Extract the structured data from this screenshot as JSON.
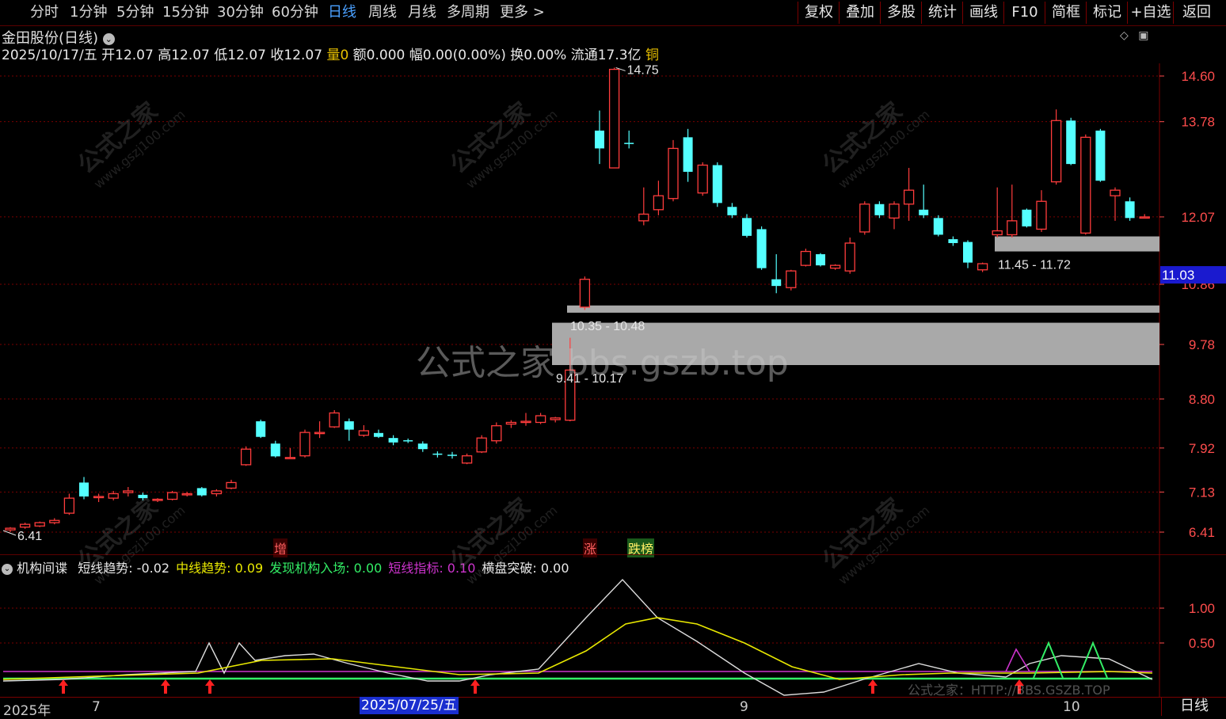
{
  "toolbar": {
    "periods": [
      "分时",
      "1分钟",
      "5分钟",
      "15分钟",
      "30分钟",
      "60分钟",
      "日线",
      "周线",
      "月线",
      "多周期",
      "更多 >"
    ],
    "active_period": "日线",
    "right_buttons": [
      "复权",
      "叠加",
      "多股",
      "统计",
      "画线",
      "F10",
      "简框",
      "标记",
      "+自选",
      "返回"
    ]
  },
  "stock": {
    "name": "金田股份(日线)",
    "date": "2025/10/17/五",
    "open_label": "开",
    "open": "12.07",
    "high_label": "高",
    "high": "12.07",
    "low_label": "低",
    "low": "12.07",
    "close_label": "收",
    "close": "12.07",
    "vol_label": "量",
    "vol": "0",
    "amount_label": "额",
    "amount": "0.000",
    "range_label": "幅",
    "range": "0.00(0.00%)",
    "turnover_label": "换",
    "turnover": "0.00%",
    "float_label": "流通",
    "float": "17.3亿",
    "sector": "铜"
  },
  "price_axis": {
    "ticks": [
      "14.60",
      "13.78",
      "12.07",
      "10.86",
      "9.78",
      "8.80",
      "7.92",
      "7.13",
      "6.41"
    ],
    "current": "11.03"
  },
  "annotations": {
    "max_price": "14.75",
    "min_price": "6.41",
    "zone1": "10.35 - 10.48",
    "zone2": "9.41 - 10.17",
    "zone3": "11.45 - 11.72",
    "tags": [
      "增",
      "涨",
      "跌榜"
    ]
  },
  "indicator": {
    "name": "机构间谍",
    "items": [
      {
        "label": "短线趋势",
        "value": "-0.02",
        "color": "#e8e8e8"
      },
      {
        "label": "中线趋势",
        "value": "0.09",
        "color": "#e8e800"
      },
      {
        "label": "发现机构入场",
        "value": "0.00",
        "color": "#33ee66"
      },
      {
        "label": "短线指标",
        "value": "0.10",
        "color": "#cc33cc"
      },
      {
        "label": "横盘突破",
        "value": "0.00",
        "color": "#e8e8e8"
      }
    ],
    "axis_ticks": [
      "1.00",
      "0.50"
    ]
  },
  "bottom": {
    "dates": [
      "2025年",
      "7",
      "9",
      "10"
    ],
    "selected_date": "2025/07/25/五",
    "day_button": "日线"
  },
  "watermarks": {
    "small": "公式之家",
    "url": "www.gszj100.com",
    "big": "公式之家  bbs.gszb.top",
    "bottom": "公式之家：HTTP://BBS.GSZB.TOP"
  },
  "colors": {
    "up": "#ff3c3c",
    "down": "#54ffff",
    "grid": "#7a0000",
    "axis_text": "#ff4d4d"
  },
  "chart_data": {
    "type": "candlestick",
    "candles": [
      {
        "o": 6.45,
        "h": 6.5,
        "l": 6.41,
        "c": 6.48
      },
      {
        "o": 6.5,
        "h": 6.58,
        "l": 6.47,
        "c": 6.55
      },
      {
        "o": 6.52,
        "h": 6.6,
        "l": 6.5,
        "c": 6.58
      },
      {
        "o": 6.58,
        "h": 6.66,
        "l": 6.55,
        "c": 6.62
      },
      {
        "o": 6.75,
        "h": 7.1,
        "l": 6.72,
        "c": 7.02
      },
      {
        "o": 7.3,
        "h": 7.4,
        "l": 7.0,
        "c": 7.05
      },
      {
        "o": 7.03,
        "h": 7.1,
        "l": 6.95,
        "c": 7.05
      },
      {
        "o": 7.02,
        "h": 7.15,
        "l": 6.98,
        "c": 7.1
      },
      {
        "o": 7.12,
        "h": 7.22,
        "l": 7.05,
        "c": 7.15
      },
      {
        "o": 7.08,
        "h": 7.12,
        "l": 6.98,
        "c": 7.02
      },
      {
        "o": 6.98,
        "h": 7.02,
        "l": 6.95,
        "c": 7.0
      },
      {
        "o": 7.0,
        "h": 7.15,
        "l": 6.98,
        "c": 7.12
      },
      {
        "o": 7.08,
        "h": 7.13,
        "l": 7.05,
        "c": 7.1
      },
      {
        "o": 7.2,
        "h": 7.22,
        "l": 7.05,
        "c": 7.07
      },
      {
        "o": 7.1,
        "h": 7.18,
        "l": 7.05,
        "c": 7.15
      },
      {
        "o": 7.2,
        "h": 7.35,
        "l": 7.18,
        "c": 7.3
      },
      {
        "o": 7.62,
        "h": 7.95,
        "l": 7.6,
        "c": 7.9
      },
      {
        "o": 8.4,
        "h": 8.43,
        "l": 8.1,
        "c": 8.12
      },
      {
        "o": 8.0,
        "h": 8.05,
        "l": 7.75,
        "c": 7.77
      },
      {
        "o": 7.75,
        "h": 7.92,
        "l": 7.73,
        "c": 7.75
      },
      {
        "o": 7.78,
        "h": 8.25,
        "l": 7.75,
        "c": 8.2
      },
      {
        "o": 8.18,
        "h": 8.4,
        "l": 8.1,
        "c": 8.2
      },
      {
        "o": 8.3,
        "h": 8.6,
        "l": 8.28,
        "c": 8.55
      },
      {
        "o": 8.4,
        "h": 8.45,
        "l": 8.05,
        "c": 8.25
      },
      {
        "o": 8.15,
        "h": 8.33,
        "l": 8.12,
        "c": 8.23
      },
      {
        "o": 8.19,
        "h": 8.25,
        "l": 8.1,
        "c": 8.12
      },
      {
        "o": 8.1,
        "h": 8.15,
        "l": 7.97,
        "c": 8.02
      },
      {
        "o": 8.06,
        "h": 8.09,
        "l": 8.01,
        "c": 8.04
      },
      {
        "o": 8.0,
        "h": 8.04,
        "l": 7.85,
        "c": 7.9
      },
      {
        "o": 7.82,
        "h": 7.86,
        "l": 7.75,
        "c": 7.8
      },
      {
        "o": 7.8,
        "h": 7.85,
        "l": 7.73,
        "c": 7.78
      },
      {
        "o": 7.65,
        "h": 7.82,
        "l": 7.63,
        "c": 7.78
      },
      {
        "o": 7.85,
        "h": 8.15,
        "l": 7.83,
        "c": 8.1
      },
      {
        "o": 8.05,
        "h": 8.38,
        "l": 8.0,
        "c": 8.32
      },
      {
        "o": 8.35,
        "h": 8.42,
        "l": 8.28,
        "c": 8.38
      },
      {
        "o": 8.4,
        "h": 8.55,
        "l": 8.32,
        "c": 8.4
      },
      {
        "o": 8.38,
        "h": 8.55,
        "l": 8.35,
        "c": 8.5
      },
      {
        "o": 8.43,
        "h": 8.48,
        "l": 8.38,
        "c": 8.46
      },
      {
        "o": 8.42,
        "h": 9.9,
        "l": 8.4,
        "c": 9.32
      },
      {
        "o": 10.45,
        "h": 11.0,
        "l": 10.4,
        "c": 10.95
      },
      {
        "o": 13.62,
        "h": 13.98,
        "l": 13.02,
        "c": 13.3
      },
      {
        "o": 12.95,
        "h": 14.75,
        "l": 12.95,
        "c": 14.72
      },
      {
        "o": 13.4,
        "h": 13.62,
        "l": 13.3,
        "c": 13.38
      },
      {
        "o": 12.0,
        "h": 12.6,
        "l": 11.92,
        "c": 12.12
      },
      {
        "o": 12.2,
        "h": 12.72,
        "l": 12.1,
        "c": 12.45
      },
      {
        "o": 12.4,
        "h": 13.45,
        "l": 12.35,
        "c": 13.3
      },
      {
        "o": 13.5,
        "h": 13.65,
        "l": 12.7,
        "c": 12.88
      },
      {
        "o": 12.5,
        "h": 13.05,
        "l": 12.45,
        "c": 13.0
      },
      {
        "o": 13.0,
        "h": 13.05,
        "l": 12.25,
        "c": 12.32
      },
      {
        "o": 12.25,
        "h": 12.32,
        "l": 12.05,
        "c": 12.1
      },
      {
        "o": 12.05,
        "h": 12.12,
        "l": 11.7,
        "c": 11.73
      },
      {
        "o": 11.85,
        "h": 11.9,
        "l": 11.12,
        "c": 11.15
      },
      {
        "o": 10.95,
        "h": 11.4,
        "l": 10.7,
        "c": 10.83
      },
      {
        "o": 10.8,
        "h": 11.12,
        "l": 10.75,
        "c": 11.1
      },
      {
        "o": 11.2,
        "h": 11.5,
        "l": 11.18,
        "c": 11.45
      },
      {
        "o": 11.4,
        "h": 11.42,
        "l": 11.18,
        "c": 11.2
      },
      {
        "o": 11.15,
        "h": 11.22,
        "l": 11.12,
        "c": 11.2
      },
      {
        "o": 11.1,
        "h": 11.7,
        "l": 11.05,
        "c": 11.6
      },
      {
        "o": 11.8,
        "h": 12.35,
        "l": 11.75,
        "c": 12.3
      },
      {
        "o": 12.3,
        "h": 12.35,
        "l": 12.05,
        "c": 12.1
      },
      {
        "o": 12.05,
        "h": 12.35,
        "l": 11.85,
        "c": 12.3
      },
      {
        "o": 12.3,
        "h": 12.95,
        "l": 12.0,
        "c": 12.55
      },
      {
        "o": 12.2,
        "h": 12.65,
        "l": 12.05,
        "c": 12.1
      },
      {
        "o": 12.05,
        "h": 12.1,
        "l": 11.72,
        "c": 11.75
      },
      {
        "o": 11.67,
        "h": 11.72,
        "l": 11.55,
        "c": 11.6
      },
      {
        "o": 11.62,
        "h": 11.65,
        "l": 11.15,
        "c": 11.25
      },
      {
        "o": 11.12,
        "h": 11.25,
        "l": 11.08,
        "c": 11.23
      },
      {
        "o": 11.75,
        "h": 12.6,
        "l": 11.7,
        "c": 11.82
      },
      {
        "o": 11.75,
        "h": 12.65,
        "l": 11.7,
        "c": 12.0
      },
      {
        "o": 12.2,
        "h": 12.22,
        "l": 11.88,
        "c": 11.9
      },
      {
        "o": 11.85,
        "h": 12.55,
        "l": 11.8,
        "c": 12.35
      },
      {
        "o": 12.7,
        "h": 14.0,
        "l": 12.65,
        "c": 13.8
      },
      {
        "o": 13.8,
        "h": 13.85,
        "l": 13.0,
        "c": 13.02
      },
      {
        "o": 11.78,
        "h": 13.55,
        "l": 11.75,
        "c": 13.5
      },
      {
        "o": 13.62,
        "h": 13.65,
        "l": 12.7,
        "c": 12.72
      },
      {
        "o": 12.45,
        "h": 12.6,
        "l": 12.0,
        "c": 12.55
      },
      {
        "o": 12.35,
        "h": 12.42,
        "l": 12.0,
        "c": 12.05
      },
      {
        "o": 12.07,
        "h": 12.12,
        "l": 12.05,
        "c": 12.07
      }
    ]
  }
}
